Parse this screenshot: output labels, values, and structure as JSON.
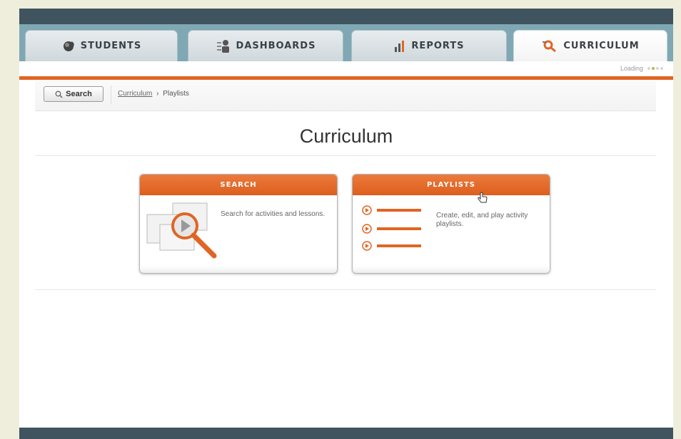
{
  "tabs": [
    {
      "label": "STUDENTS",
      "icon": "students-icon"
    },
    {
      "label": "DASHBOARDS",
      "icon": "dashboards-icon"
    },
    {
      "label": "REPORTS",
      "icon": "reports-icon"
    },
    {
      "label": "CURRICULUM",
      "icon": "curriculum-icon",
      "active": true
    }
  ],
  "status": {
    "loading_text": "Loading"
  },
  "breadcrumb": {
    "search_label": "Search",
    "items": [
      "Curriculum",
      "Playlists"
    ],
    "separator": "›"
  },
  "page": {
    "title": "Curriculum"
  },
  "cards": [
    {
      "title": "SEARCH",
      "description": "Search for activities and lessons.",
      "icon": "search-magnifier-icon"
    },
    {
      "title": "PLAYLISTS",
      "description": "Create, edit, and play activity playlists.",
      "icon": "playlist-icon"
    }
  ],
  "colors": {
    "accent": "#e06524",
    "tab_band": "#7fa8b4",
    "header_dark": "#3f545f"
  }
}
